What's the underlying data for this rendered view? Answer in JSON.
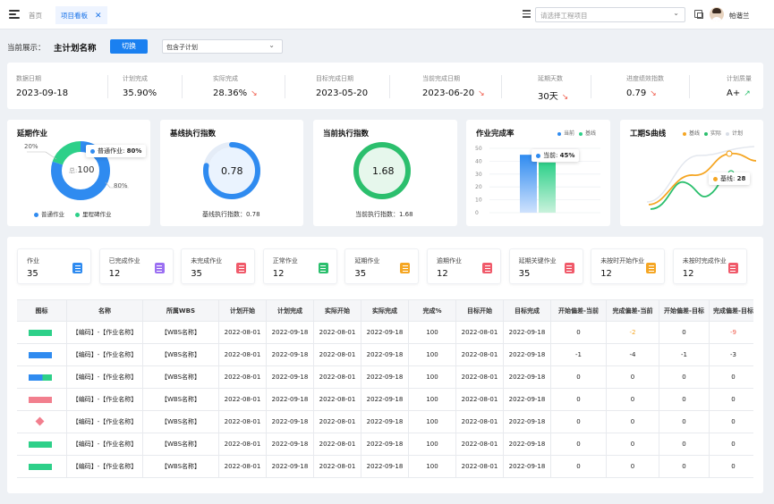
{
  "topbar": {
    "tab_home": "首页",
    "tab_active": "项目看板",
    "tab_close": "✕",
    "project_placeholder": "请选择工程项目",
    "username": "帕谐兰"
  },
  "filters": {
    "label": "当前展示：",
    "plan_name": "主计划名称",
    "switch_label": "切换",
    "sub_plan_option": "包含子计划"
  },
  "stats": [
    {
      "label": "数据日期",
      "value": "2023-09-18",
      "trend": ""
    },
    {
      "label": "计划完成",
      "value": "35.90%",
      "trend": ""
    },
    {
      "label": "实际完成",
      "value": "28.36%",
      "trend": "down"
    },
    {
      "label": "目标完成日期",
      "value": "2023-05-20",
      "trend": ""
    },
    {
      "label": "当前完成日期",
      "value": "2023-06-20",
      "trend": "down"
    },
    {
      "label": "延期天数",
      "value": "30天",
      "trend": "down"
    },
    {
      "label": "进度绩效指数",
      "value": "0.79",
      "trend": "down"
    },
    {
      "label": "计划质量",
      "value": "A+",
      "trend": "up"
    }
  ],
  "colors": {
    "primary": "#1a80f0",
    "green": "#2bbf6d",
    "down_arrow": "#f05a4a",
    "up_arrow": "#2bbf6d",
    "orange": "#f5a623"
  },
  "widgets": {
    "delay": {
      "title": "延期作业",
      "total_label": "总:",
      "total_value": "100",
      "pct_small": "20%",
      "pct_large": "80%",
      "tooltip_label": "普通作业:",
      "tooltip_value": "80%",
      "legend": [
        "普通作业",
        "里程碑作业"
      ]
    },
    "baseline_index": {
      "title": "基线执行指数",
      "value": "0.78",
      "caption": "基线执行指数：0.78",
      "fraction": 0.78
    },
    "current_index": {
      "title": "当前执行指数",
      "value": "1.68",
      "caption": "当前执行指数：1.68"
    },
    "completion": {
      "title": "作业完成率",
      "legend": [
        "当前",
        "基线"
      ],
      "tooltip_label": "当前:",
      "tooltip_value": "45%"
    },
    "scurve": {
      "title": "工期S曲线",
      "legend": [
        "基线",
        "实际",
        "计划"
      ],
      "tooltip_label": "基线:",
      "tooltip_value": "28"
    }
  },
  "chart_data": {
    "type": "bar",
    "title": "作业完成率",
    "series": [
      {
        "name": "当前",
        "values": [
          45
        ]
      },
      {
        "name": "基线",
        "values": [
          39
        ]
      }
    ],
    "ylim": [
      0,
      50
    ],
    "yticks": [
      "50",
      "40",
      "30",
      "20",
      "10",
      "0"
    ]
  },
  "kpis": [
    {
      "label": "作业",
      "value": "35",
      "color": "#2f8bf0"
    },
    {
      "label": "已完成作业",
      "value": "12",
      "color": "#9b6ff2"
    },
    {
      "label": "未完成作业",
      "value": "35",
      "color": "#f05a6a"
    },
    {
      "label": "正常作业",
      "value": "12",
      "color": "#2bbf6d"
    },
    {
      "label": "延期作业",
      "value": "35",
      "color": "#f5a623"
    },
    {
      "label": "逾期作业",
      "value": "12",
      "color": "#f05a6a"
    },
    {
      "label": "延期关键作业",
      "value": "35",
      "color": "#f05a6a"
    },
    {
      "label": "未按时开始作业",
      "value": "12",
      "color": "#f5a623"
    },
    {
      "label": "未按时完成作业",
      "value": "12",
      "color": "#f05a6a"
    }
  ],
  "table": {
    "headers": [
      "图标",
      "名称",
      "所属WBS",
      "计划开始",
      "计划完成",
      "实际开始",
      "实际完成",
      "完成%",
      "目标开始",
      "目标完成",
      "开始偏差-当前",
      "完成偏差-当前",
      "开始偏差-目标",
      "完成偏差-目标"
    ],
    "rows": [
      {
        "icon": "green",
        "cells": [
          "【编码】-【作业名称】",
          "【WBS名称】",
          "2022-08-01",
          "2022-09-18",
          "2022-08-01",
          "2022-09-18",
          "100",
          "2022-08-01",
          "2022-09-18",
          "0",
          "-2",
          "0",
          "-9"
        ]
      },
      {
        "icon": "blue",
        "cells": [
          "【编码】-【作业名称】",
          "【WBS名称】",
          "2022-08-01",
          "2022-09-18",
          "2022-08-01",
          "2022-09-18",
          "100",
          "2022-08-01",
          "2022-09-18",
          "-1",
          "-4",
          "-1",
          "-3"
        ]
      },
      {
        "icon": "bluegreen",
        "cells": [
          "【编码】-【作业名称】",
          "【WBS名称】",
          "2022-08-01",
          "2022-09-18",
          "2022-08-01",
          "2022-09-18",
          "100",
          "2022-08-01",
          "2022-09-18",
          "0",
          "0",
          "0",
          "0"
        ]
      },
      {
        "icon": "pink",
        "cells": [
          "【编码】-【作业名称】",
          "【WBS名称】",
          "2022-08-01",
          "2022-09-18",
          "2022-08-01",
          "2022-09-18",
          "100",
          "2022-08-01",
          "2022-09-18",
          "0",
          "0",
          "0",
          "0"
        ]
      },
      {
        "icon": "diamond",
        "cells": [
          "【编码】-【作业名称】",
          "【WBS名称】",
          "2022-08-01",
          "2022-09-18",
          "2022-08-01",
          "2022-09-18",
          "100",
          "2022-08-01",
          "2022-09-18",
          "0",
          "0",
          "0",
          "0"
        ]
      },
      {
        "icon": "green",
        "cells": [
          "【编码】-【作业名称】",
          "【WBS名称】",
          "2022-08-01",
          "2022-09-18",
          "2022-08-01",
          "2022-09-18",
          "100",
          "2022-08-01",
          "2022-09-18",
          "0",
          "0",
          "0",
          "0"
        ]
      },
      {
        "icon": "green",
        "cells": [
          "【编码】-【作业名称】",
          "【WBS名称】",
          "2022-08-01",
          "2022-09-18",
          "2022-08-01",
          "2022-09-18",
          "100",
          "2022-08-01",
          "2022-09-18",
          "0",
          "0",
          "0",
          "0"
        ]
      }
    ]
  }
}
